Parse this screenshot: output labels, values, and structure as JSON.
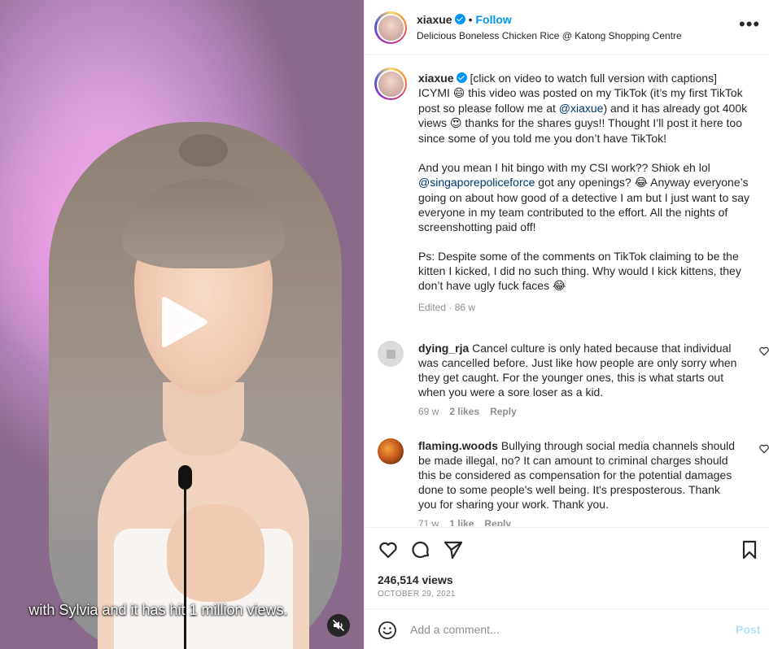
{
  "video": {
    "subtitle": "with Sylvia and it has hit 1 million views.",
    "play_icon": "play-icon",
    "mute_icon": "muted-speaker-icon"
  },
  "header": {
    "username": "xiaxue",
    "separator": "•",
    "follow_label": "Follow",
    "location": "Delicious Boneless Chicken Rice @ Katong Shopping Centre",
    "more_label": "•••"
  },
  "caption": {
    "username": "xiaxue",
    "first_line": "[click on video to watch full version with captions]",
    "p1_a": "ICYMI ",
    "p1_emoji1": "😄",
    "p1_b": " this video was posted on my TikTok (it’s my first TikTok post so please follow me at ",
    "p1_mention": "@xiaxue",
    "p1_c": ") and it has already got 400k views ",
    "p1_emoji2": "😍",
    "p1_d": " thanks for the shares guys!! Thought I’ll post it here too since some of you told me you don’t have TikTok!",
    "p2_a": "And you mean I hit bingo with my CSI work?? Shiok eh lol ",
    "p2_mention": "@singaporepoliceforce",
    "p2_b": " got any openings? ",
    "p2_emoji": "😂",
    "p2_c": " Anyway everyone’s going on about how good of a detective I am but I just want to say everyone in my team contributed to the effort. All the nights of screenshotting paid off!",
    "p3_a": "Ps: Despite some of the comments on TikTok claiming to be the kitten I kicked, I did no such thing. Why would I kick kittens, they don’t have ugly fuck faces ",
    "p3_emoji": "😂",
    "meta": "Edited · 86 w"
  },
  "comments": [
    {
      "username": "dying_rja",
      "text": "Cancel culture is only hated because that individual was cancelled before. Just like how people are only sorry when they get caught. For the younger ones, this is what starts out when you were a sore loser as a kid.",
      "age": "69 w",
      "likes": "2 likes",
      "reply": "Reply"
    },
    {
      "username": "flaming.woods",
      "text": "Bullying through social media channels should be made illegal, no? It can amount to criminal charges should this be considered as compensation for the potential damages done to some people's well being. It's presposterous. Thank you for sharing your work. Thank you.",
      "age": "71 w",
      "likes": "1 like",
      "reply": "Reply"
    }
  ],
  "actions": {
    "views": "246,514 views",
    "date": "OCTOBER 29, 2021"
  },
  "add_comment": {
    "placeholder": "Add a comment...",
    "post_label": "Post"
  },
  "colors": {
    "link_blue": "#0095f6",
    "mention": "#00376b",
    "muted": "#8e8e8e",
    "post_disabled": "#b2dffc"
  }
}
